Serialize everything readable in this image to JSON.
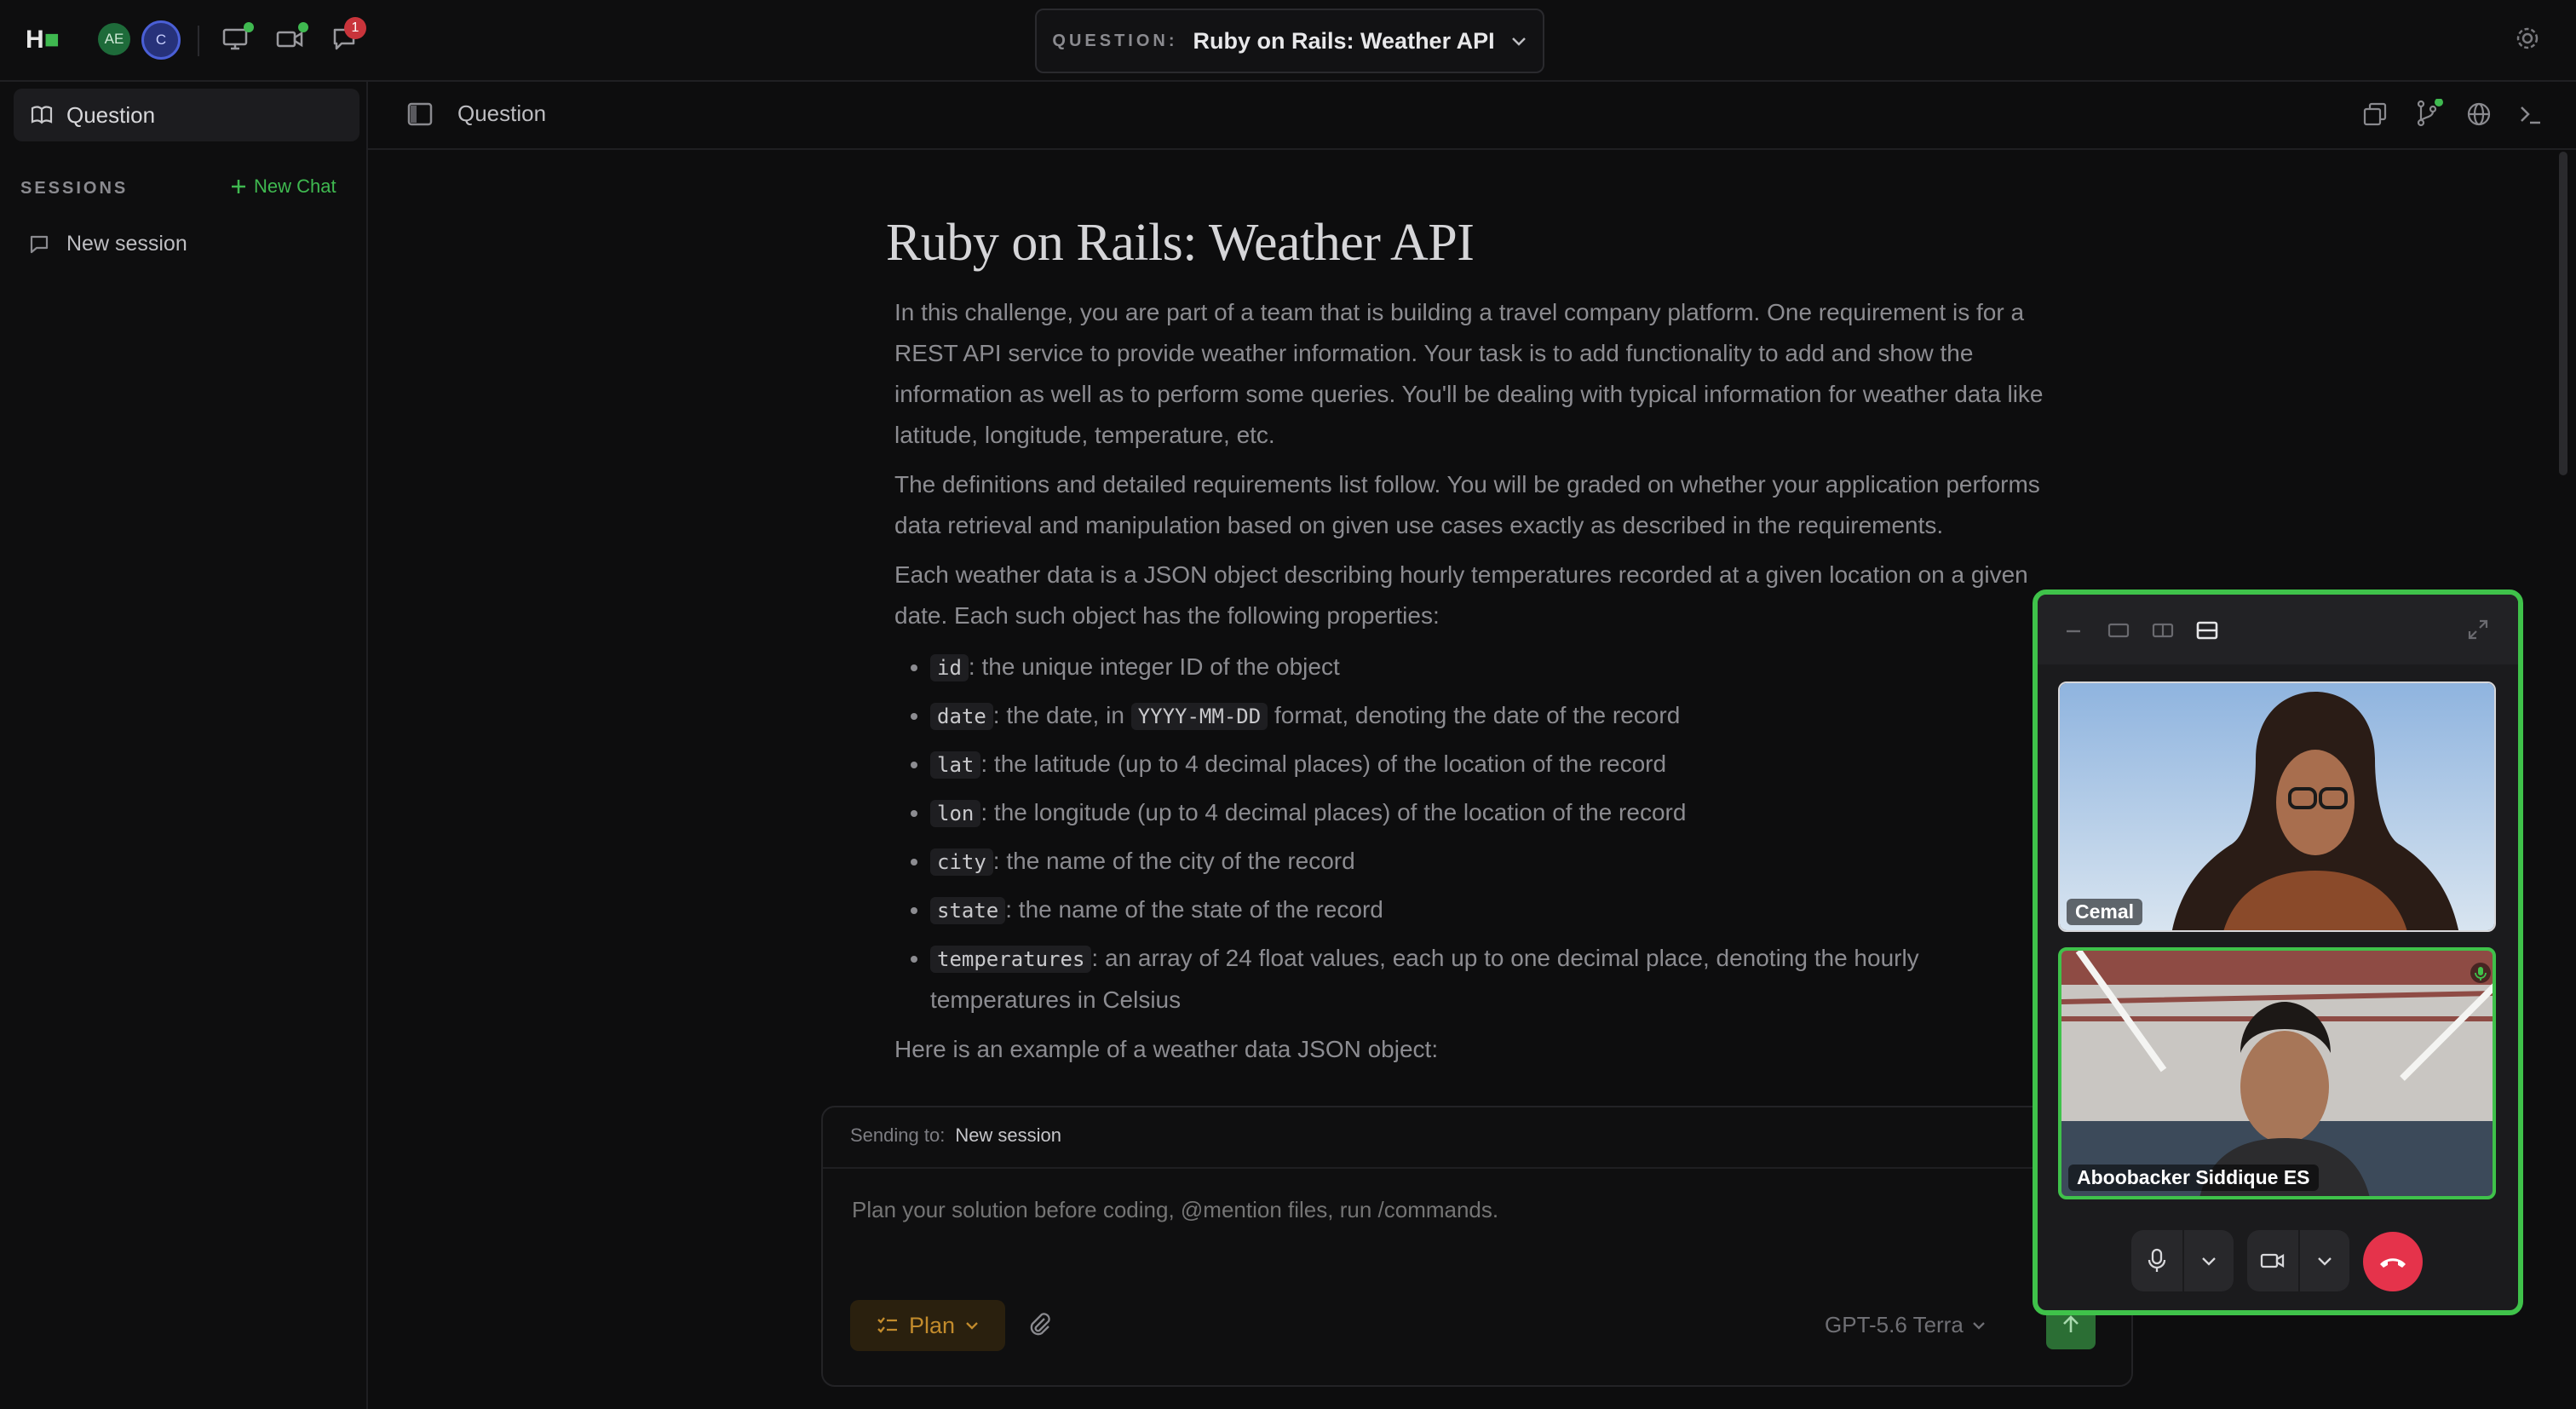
{
  "topbar": {
    "logo": "H",
    "avatars": [
      "AE",
      "C"
    ],
    "notification_count": "1",
    "question_label": "QUESTION:",
    "question_value": "Ruby on Rails: Weather API"
  },
  "sidebar": {
    "question_tab": "Question",
    "sessions_label": "SESSIONS",
    "new_chat": "New Chat",
    "session_items": [
      "New session"
    ]
  },
  "main": {
    "header_title": "Question",
    "doc_title": "Ruby on Rails: Weather API",
    "paragraphs": [
      "In this challenge, you are part of a team that is building a travel company platform. One requirement is for a REST API service to provide weather information. Your task is to add functionality to add and show the information as well as to perform some queries. You'll be dealing with typical information for weather data like latitude, longitude, temperature, etc.",
      "The definitions and detailed requirements list follow. You will be graded on whether your application performs data retrieval and manipulation based on given use cases exactly as described in the requirements.",
      "Each weather data is a JSON object describing hourly temperatures recorded at a given location on a given date. Each such object has the following properties:"
    ],
    "properties": [
      {
        "code": "id",
        "text": ": the unique integer ID of the object"
      },
      {
        "code": "date",
        "text": ": the date, in ",
        "code2": "YYYY-MM-DD",
        "text2": " format, denoting the date of the record"
      },
      {
        "code": "lat",
        "text": ": the latitude (up to 4 decimal places) of the location of the record"
      },
      {
        "code": "lon",
        "text": ": the longitude (up to 4 decimal places) of the location of the record"
      },
      {
        "code": "city",
        "text": ": the name of the city of the record"
      },
      {
        "code": "state",
        "text": ": the name of the state of the record"
      },
      {
        "code": "temperatures",
        "text": ": an array of 24 float values, each up to one decimal place, denoting the hourly temperatures in Celsius"
      }
    ],
    "example_intro": "Here is an example of a weather data JSON object:"
  },
  "chat": {
    "sending_to_label": "Sending to:",
    "sending_to_value": "New session",
    "input_placeholder": "Plan your solution before coding, @mention files, run /commands.",
    "plan_button": "Plan",
    "model": "GPT-5.6 Terra"
  },
  "video": {
    "participants": [
      "Cemal",
      "Aboobacker Siddique ES"
    ]
  },
  "colors": {
    "accent_green": "#3fc24a",
    "hangup_red": "#e5334b",
    "plan_amber": "#c28b2c"
  }
}
